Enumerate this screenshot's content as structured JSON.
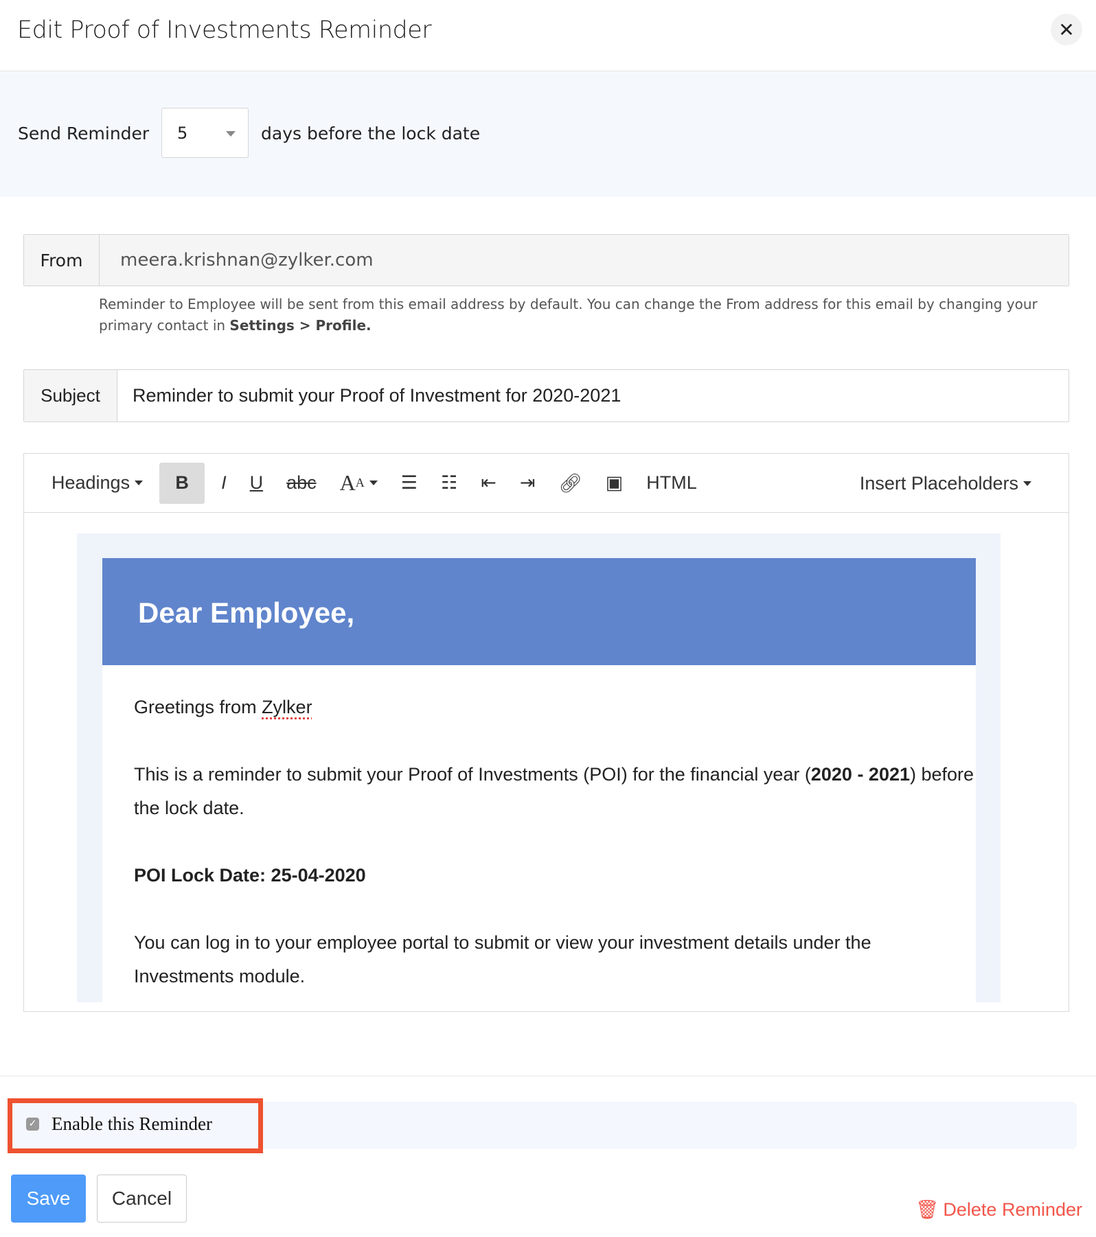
{
  "dialog": {
    "title": "Edit Proof of Investments Reminder",
    "close_icon": "close-icon"
  },
  "reminder": {
    "label": "Send Reminder",
    "days_value": "5",
    "suffix": "days before the lock date"
  },
  "from": {
    "label": "From",
    "value": "meera.krishnan@zylker.com",
    "help_prefix": "Reminder to Employee will be sent from this email address by default. You can change the From address for this email by changing your primary contact in ",
    "help_bold": "Settings > Profile."
  },
  "subject": {
    "label": "Subject",
    "value": "Reminder to submit your Proof of Investment for 2020-2021"
  },
  "toolbar": {
    "headings": "Headings",
    "bold": "B",
    "italic": "I",
    "underline": "U",
    "strike": "abc",
    "font_size": "A",
    "html": "HTML",
    "insert_placeholders": "Insert Placeholders"
  },
  "email": {
    "heading": "Dear Employee,",
    "greeting_prefix": "Greetings from ",
    "company": "Zylker",
    "para1_prefix": "This is a reminder to submit your Proof of Investments (POI) for the financial year (",
    "para1_bold": "2020 - 2021",
    "para1_suffix": ") before the lock date.",
    "lock_date": "POI Lock Date: 25-04-2020",
    "para3": "You can log in to your employee portal to submit or view your investment details under the Investments module."
  },
  "footer": {
    "enable_label": "Enable this Reminder",
    "enabled": true,
    "save": "Save",
    "cancel": "Cancel",
    "delete": "Delete Reminder"
  },
  "colors": {
    "accent": "#4e9bf9",
    "header_blue": "#6085cc",
    "delete_red": "#f2564a",
    "highlight": "#ee5230"
  }
}
